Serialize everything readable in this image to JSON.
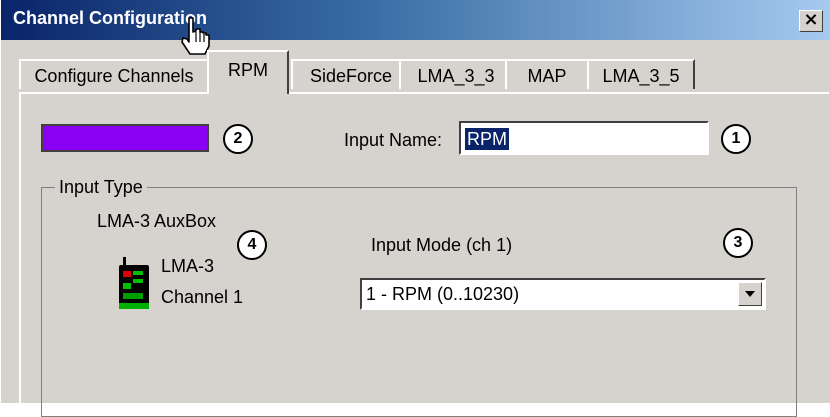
{
  "window": {
    "title": "Channel Configuration",
    "close_label": "×"
  },
  "tabs": [
    {
      "label": "Configure Channels",
      "active": false
    },
    {
      "label": "RPM",
      "active": true
    },
    {
      "label": "SideForce",
      "active": false
    },
    {
      "label": "LMA_3_3",
      "active": false
    },
    {
      "label": "MAP",
      "active": false
    },
    {
      "label": "LMA_3_5",
      "active": false
    }
  ],
  "color_swatch": {
    "color": "#8a00f0"
  },
  "input_name": {
    "label": "Input Name:",
    "value": "RPM"
  },
  "input_type": {
    "group_label": "Input Type",
    "device_label": "LMA-3 AuxBox",
    "device_name": "LMA-3",
    "channel": "Channel 1",
    "input_mode_label": "Input Mode (ch 1)",
    "input_mode_value": "1 - RPM (0..10230)"
  },
  "callouts": {
    "one": "1",
    "two": "2",
    "three": "3",
    "four": "4"
  },
  "colors": {
    "dialog_bg": "#d6d3ce",
    "title_start": "#0a246a",
    "selection": "#0a246a"
  }
}
